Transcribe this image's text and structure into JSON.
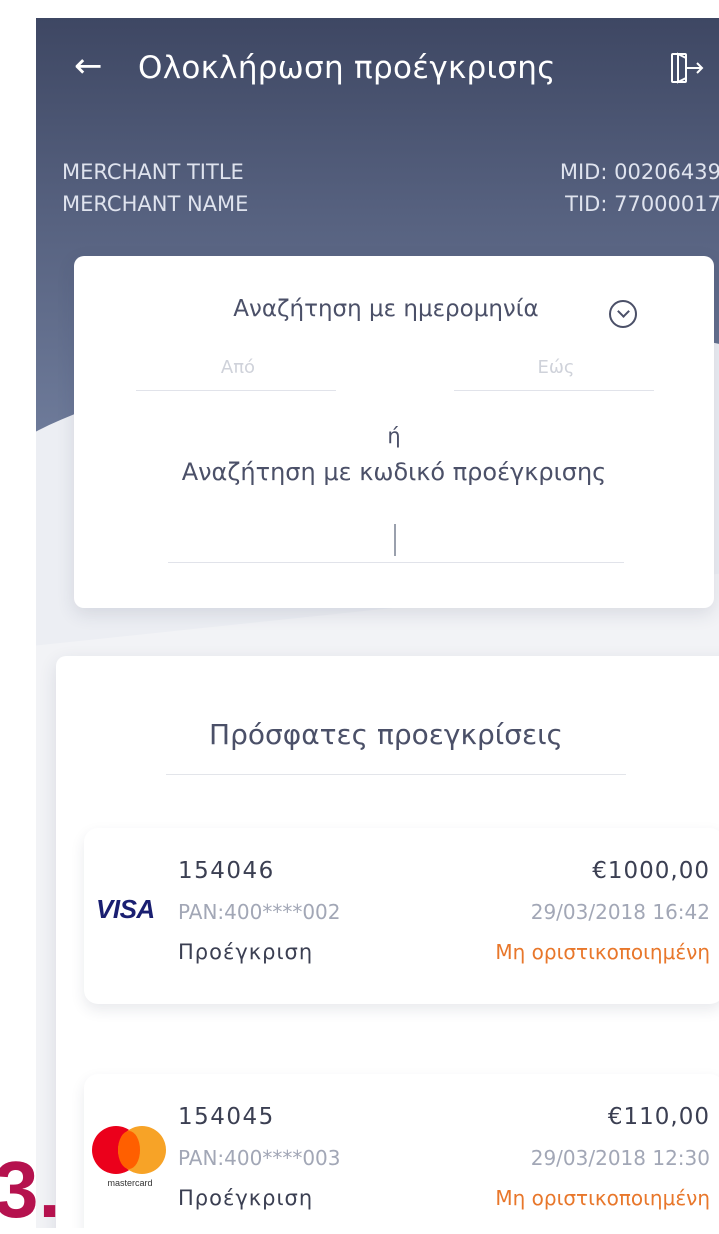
{
  "header": {
    "back_icon": "arrow-left-icon",
    "title": "Ολοκλήρωση προέγκρισης",
    "exit_icon": "logout-icon"
  },
  "merchant": {
    "title": "MERCHANT TITLE",
    "name": "MERCHANT NAME",
    "mid": "MID: 00206439",
    "tid": "TID: 77000017"
  },
  "search": {
    "date_label": "Αναζήτηση με ημερομηνία",
    "from_placeholder": "Από",
    "to_placeholder": "Εώς",
    "or_text": "ή",
    "code_label": "Αναζήτηση με κωδικό προέγκρισης",
    "code_value": ""
  },
  "recent": {
    "title": "Πρόσφατες προεγκρίσεις",
    "items": [
      {
        "code": "154046",
        "amount": "€1000,00",
        "card_brand": "VISA",
        "pan": "PAN:400****002",
        "date": "29/03/2018 16:42",
        "type": "Προέγκριση",
        "status": "Μη οριστικοποιημένη"
      },
      {
        "code": "154045",
        "amount": "€110,00",
        "card_brand": "mastercard",
        "pan": "PAN:400****003",
        "date": "29/03/2018 12:30",
        "type": "Προέγκριση",
        "status": "Μη οριστικοποιημένη"
      }
    ]
  },
  "overlay_label": "3.",
  "colors": {
    "header": "#3e4763",
    "status_pending": "#e8772b",
    "text_dark": "#3b3f52",
    "overlay": "#b5124e"
  }
}
